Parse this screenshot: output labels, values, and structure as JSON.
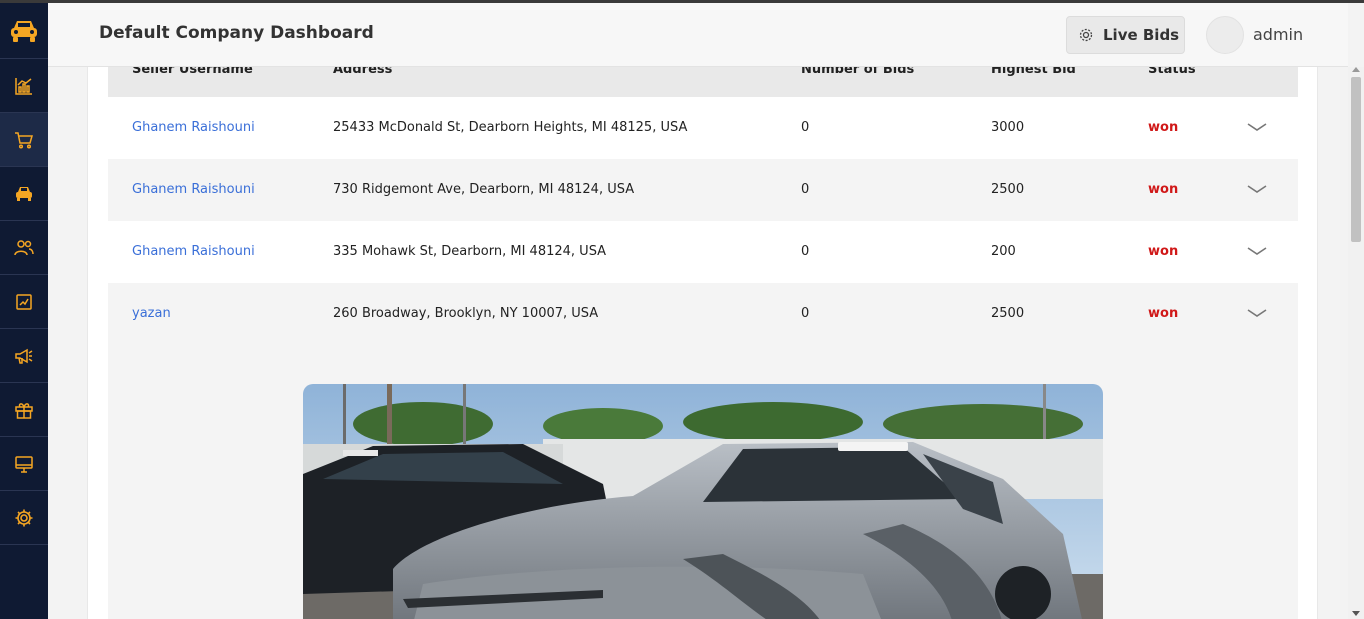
{
  "header": {
    "title": "Default Company Dashboard",
    "live_bids_label": "Live Bids",
    "username": "admin"
  },
  "sidebar": {
    "icons": [
      "car-logo-icon",
      "analytics-icon",
      "cart-icon",
      "car-icon",
      "users-icon",
      "reports-icon",
      "megaphone-icon",
      "gift-icon",
      "monitor-icon",
      "settings-icon"
    ],
    "active_index": 2,
    "accent": "#f5a623"
  },
  "table": {
    "columns": [
      "Seller Username",
      "Address",
      "Number of Bids",
      "Highest Bid",
      "Status"
    ],
    "rows": [
      {
        "seller": "Ghanem Raishouni",
        "address": "25433 McDonald St, Dearborn Heights, MI 48125, USA",
        "bids": "0",
        "highest": "3000",
        "status": "won"
      },
      {
        "seller": "Ghanem Raishouni",
        "address": "730 Ridgemont Ave, Dearborn, MI 48124, USA",
        "bids": "0",
        "highest": "2500",
        "status": "won"
      },
      {
        "seller": "Ghanem Raishouni",
        "address": "335 Mohawk St, Dearborn, MI 48124, USA",
        "bids": "0",
        "highest": "200",
        "status": "won"
      },
      {
        "seller": "yazan",
        "address": "260 Broadway, Brooklyn, NY 10007, USA",
        "bids": "0",
        "highest": "2500",
        "status": "won"
      }
    ],
    "status_color": "#d01818",
    "link_color": "#3a6fd8"
  }
}
